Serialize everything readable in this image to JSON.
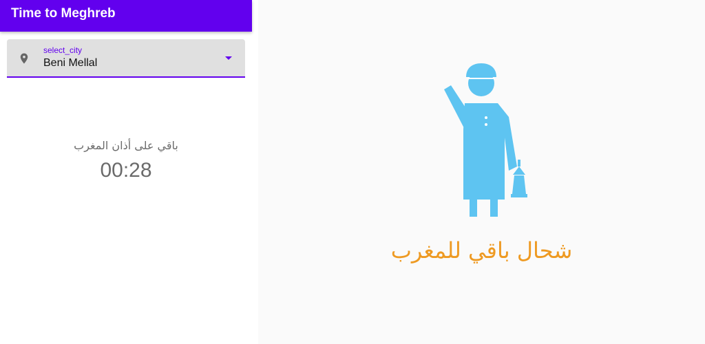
{
  "app_bar": {
    "title": "Time to Meghreb"
  },
  "city_select": {
    "label": "select_city",
    "value": "Beni Mellal",
    "leading_icon": "location-pin-icon",
    "trailing_icon": "dropdown-arrow-icon"
  },
  "countdown": {
    "label": "باقي على أذان المغرب",
    "time": "00:28"
  },
  "splash": {
    "illustration": "man-with-lantern-icon",
    "title": "شحال باقي للمغرب"
  },
  "colors": {
    "primary": "#6200ee",
    "illustration": "#5ec4f1",
    "splash_title": "#ee9a22"
  }
}
